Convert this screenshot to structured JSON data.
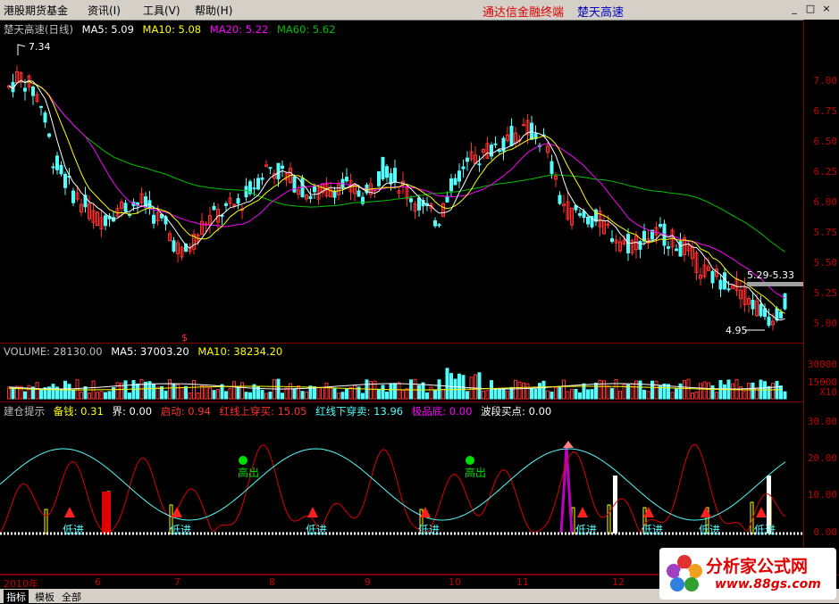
{
  "menu": {
    "items": [
      "港股期货基金",
      "资讯(I)",
      "工具(V)",
      "帮助(H)"
    ],
    "brand": "通达信金融终端",
    "stock": "楚天高速",
    "window_controls": [
      "_",
      "□",
      "×"
    ]
  },
  "price_panel": {
    "legend": {
      "name": "楚天高速(日线)",
      "ma5": "MA5: 5.09",
      "ma10": "MA10: 5.08",
      "ma20": "MA20: 5.22",
      "ma60": "MA60: 5.62"
    },
    "y_ticks": [
      "7.00",
      "6.75",
      "6.50",
      "6.25",
      "6.00",
      "5.75",
      "5.50",
      "5.25",
      "5.00"
    ],
    "annotations": {
      "high": "7.34",
      "low": "4.95",
      "range": "5.29-5.33",
      "marker": "$"
    }
  },
  "volume_panel": {
    "legend": {
      "name": "VOLUME: 28130.00",
      "ma5": "MA5: 37003.20",
      "ma10": "MA10: 38234.20"
    },
    "y_ticks": [
      "30000",
      "15000",
      "X10"
    ]
  },
  "indicator_panel": {
    "legend": {
      "name": "建仓提示",
      "beiqian": "备钱: 0.31",
      "jie": "界: 0.00",
      "qidong": "启动: 0.94",
      "hong_up": "红线上穿买: 15.05",
      "hong_down": "红线下穿卖: 13.96",
      "jipindi": "极品底: 0.00",
      "boduan": "波段买点: 0.00"
    },
    "y_ticks": [
      "30.00",
      "20.00",
      "10.00",
      "0.00"
    ],
    "labels": {
      "sell": "高出",
      "buy": "低进"
    }
  },
  "time_axis": [
    "2010年",
    "6",
    "7",
    "8",
    "9",
    "10",
    "11",
    "12"
  ],
  "tabs": [
    "指标",
    "模板",
    "全部"
  ],
  "watermark": {
    "title": "分析家公式网",
    "url": "www.88gs.com"
  },
  "colors": {
    "up": "#ff3030",
    "down": "#54fcfc",
    "ma5": "#ffffff",
    "ma10": "#ffff00",
    "ma20": "#ff00ff",
    "ma60": "#00c000"
  }
}
